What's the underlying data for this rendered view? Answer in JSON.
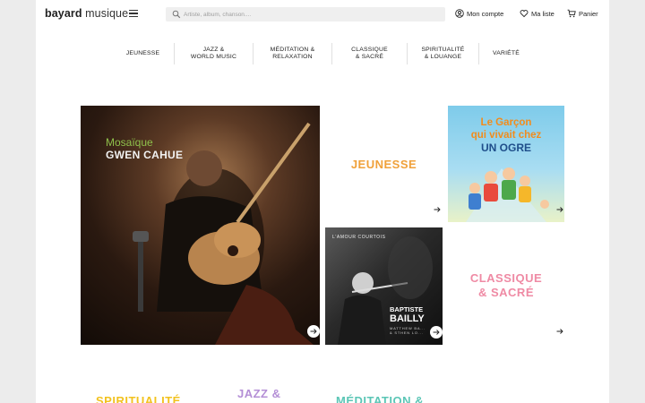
{
  "header": {
    "logo_bold": "bayard",
    "logo_light": "musique",
    "search_placeholder": "Artiste, album, chanson....",
    "account_label": "Mon compte",
    "list_label": "Ma liste",
    "cart_label": "Panier"
  },
  "nav": {
    "items": [
      {
        "label": "JEUNESSE"
      },
      {
        "label": "JAZZ &\nWORLD MUSIC"
      },
      {
        "label": "MÉDITATION &\nRELAXATION"
      },
      {
        "label": "CLASSIQUE\n& SACRÉ"
      },
      {
        "label": "SPIRITUALITÉ\n& LOUANGE"
      },
      {
        "label": "VARIÉTÉ"
      }
    ]
  },
  "tiles": {
    "hero": {
      "title_line1": "Mosaïque",
      "title_line2": "GWEN CAHUE"
    },
    "jeunesse": {
      "label": "JEUNESSE"
    },
    "ogre": {
      "title_line1": "Le Garçon",
      "title_line2": "qui vivait chez",
      "title_line3": "UN OGRE"
    },
    "bailly": {
      "top_text": "L'AMOUR COURTOIS",
      "name_line1": "BAPTISTE",
      "name_line2": "BAILLY",
      "sub_line1": "MATTHEW BA...",
      "sub_line2": "& STHEN LO..."
    },
    "classique": {
      "label_line1": "CLASSIQUE",
      "label_line2": "& SACRÉ"
    }
  },
  "bottom_categories": [
    {
      "label": "SPIRITUALITÉ"
    },
    {
      "label": "JAZZ &"
    },
    {
      "label": "MÉDITATION &"
    }
  ],
  "colors": {
    "jeunesse": "#f0a13a",
    "classique": "#ef8aa4",
    "spiritualite": "#f2c21f",
    "jazz": "#b48fd6",
    "meditation": "#5cc6b6"
  },
  "icons": {
    "search": "search-icon",
    "menu": "hamburger-menu-icon",
    "account": "user-circle-icon",
    "list": "heart-icon",
    "cart": "cart-icon",
    "arrow": "arrow-right-icon"
  }
}
